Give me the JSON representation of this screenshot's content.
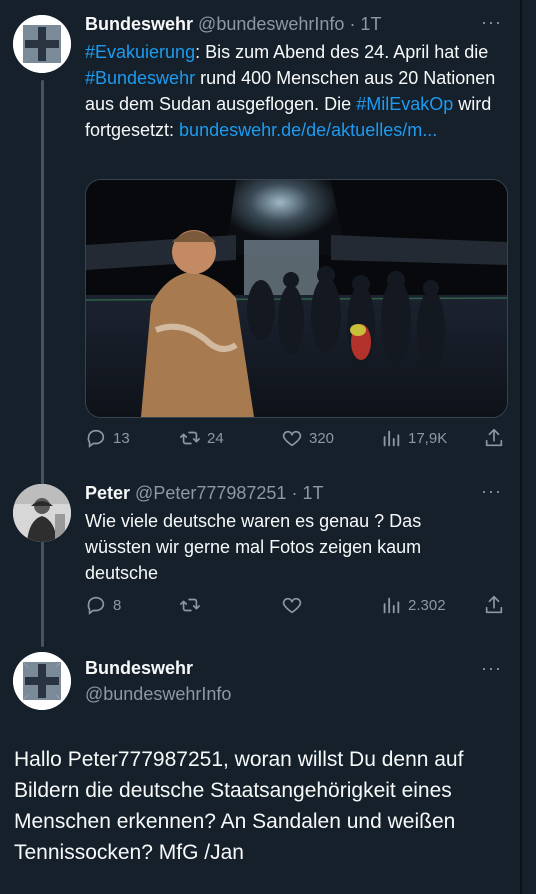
{
  "tweet1": {
    "name": "Bundeswehr",
    "handle": "@bundeswehrInfo",
    "time": "· 1T",
    "text_parts": {
      "tag1": "#Evakuierung",
      "t1": ": Bis zum Abend des 24. April hat die ",
      "tag2": "#Bundeswehr",
      "t2": " rund 400 Menschen aus 20 Nationen aus dem Sudan ausgeflogen. Die ",
      "tag3": "#MilEvakOp",
      "t3": " wird fortgesetzt: ",
      "link": "bundeswehr.de/de/aktuelles/m..."
    },
    "stats": {
      "replies": "13",
      "retweets": "24",
      "likes": "320",
      "views": "17,9K"
    }
  },
  "tweet2": {
    "name": "Peter",
    "handle": "@Peter777987251",
    "time": "· 1T",
    "text": "Wie viele deutsche waren es genau ? Das wüssten wir gerne mal Fotos zeigen kaum deutsche",
    "stats": {
      "replies": "8",
      "retweets": "",
      "likes": "",
      "views": "2.302"
    }
  },
  "tweet3": {
    "name": "Bundeswehr",
    "handle": "@bundeswehrInfo",
    "text": "Hallo Peter777987251, woran willst Du denn auf Bildern die deutsche Staatsangehörigkeit eines Menschen erkennen? An Sandalen und weißen Tennissocken? MfG /Jan"
  },
  "ui": {
    "more": "···"
  },
  "icons": [
    "reply-icon",
    "retweet-icon",
    "like-icon",
    "views-icon",
    "share-icon",
    "more-icon",
    "iron-cross-logo"
  ],
  "colors": {
    "background": "#15202b",
    "link": "#1d9bf0",
    "muted": "#8b98a5",
    "text": "#f7f9f9"
  }
}
